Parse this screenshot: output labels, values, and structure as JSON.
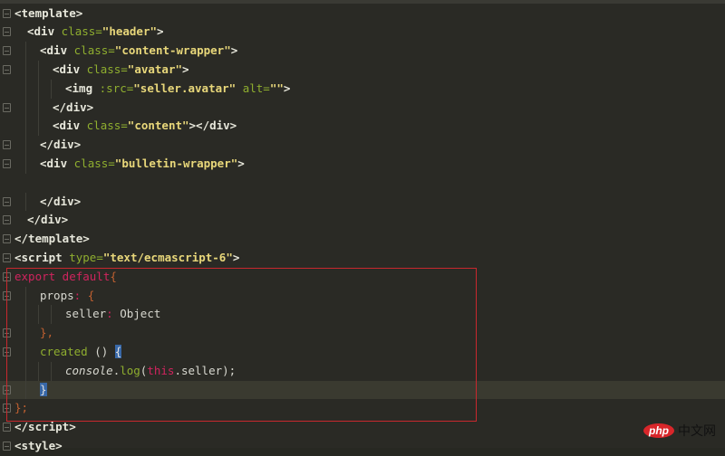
{
  "editor": {
    "current_line": 20,
    "lines": [
      {
        "indent": 0,
        "fold": true,
        "tokens": [
          {
            "t": "<template>",
            "c": "tag"
          }
        ]
      },
      {
        "indent": 1,
        "fold": true,
        "tokens": [
          {
            "t": "<div ",
            "c": "tag"
          },
          {
            "t": "class=",
            "c": "attr"
          },
          {
            "t": "\"header\"",
            "c": "str"
          },
          {
            "t": ">",
            "c": "tag"
          }
        ]
      },
      {
        "indent": 2,
        "fold": true,
        "tokens": [
          {
            "t": "<div ",
            "c": "tag"
          },
          {
            "t": "class=",
            "c": "attr"
          },
          {
            "t": "\"content-wrapper\"",
            "c": "str"
          },
          {
            "t": ">",
            "c": "tag"
          }
        ]
      },
      {
        "indent": 3,
        "fold": true,
        "tokens": [
          {
            "t": "<div ",
            "c": "tag"
          },
          {
            "t": "class=",
            "c": "attr"
          },
          {
            "t": "\"avatar\"",
            "c": "str"
          },
          {
            "t": ">",
            "c": "tag"
          }
        ]
      },
      {
        "indent": 4,
        "fold": false,
        "tokens": [
          {
            "t": "<img ",
            "c": "tag"
          },
          {
            "t": ":src=",
            "c": "attr"
          },
          {
            "t": "\"seller.avatar\"",
            "c": "str"
          },
          {
            "t": " alt=",
            "c": "attr"
          },
          {
            "t": "\"\"",
            "c": "str"
          },
          {
            "t": ">",
            "c": "tag"
          }
        ]
      },
      {
        "indent": 3,
        "fold": true,
        "tokens": [
          {
            "t": "</div>",
            "c": "tag"
          }
        ]
      },
      {
        "indent": 3,
        "fold": false,
        "tokens": [
          {
            "t": "<div ",
            "c": "tag"
          },
          {
            "t": "class=",
            "c": "attr"
          },
          {
            "t": "\"content\"",
            "c": "str"
          },
          {
            "t": "></div>",
            "c": "tag"
          }
        ]
      },
      {
        "indent": 2,
        "fold": true,
        "tokens": [
          {
            "t": "</div>",
            "c": "tag"
          }
        ]
      },
      {
        "indent": 2,
        "fold": true,
        "tokens": [
          {
            "t": "<div ",
            "c": "tag"
          },
          {
            "t": "class=",
            "c": "attr"
          },
          {
            "t": "\"bulletin-wrapper\"",
            "c": "str"
          },
          {
            "t": ">",
            "c": "tag"
          }
        ]
      },
      {
        "indent": 0,
        "fold": false,
        "tokens": []
      },
      {
        "indent": 2,
        "fold": true,
        "tokens": [
          {
            "t": "</div>",
            "c": "tag"
          }
        ]
      },
      {
        "indent": 1,
        "fold": true,
        "tokens": [
          {
            "t": "</div>",
            "c": "tag"
          }
        ]
      },
      {
        "indent": 0,
        "fold": true,
        "tokens": [
          {
            "t": "</template>",
            "c": "tag"
          }
        ]
      },
      {
        "indent": 0,
        "fold": true,
        "tokens": [
          {
            "t": "<script ",
            "c": "tag"
          },
          {
            "t": "type=",
            "c": "attr"
          },
          {
            "t": "\"text/ecmascript-6\"",
            "c": "str"
          },
          {
            "t": ">",
            "c": "tag"
          }
        ]
      },
      {
        "indent": 0,
        "fold": true,
        "tokens": [
          {
            "t": "export default",
            "c": "kw"
          },
          {
            "t": "{",
            "c": "punc"
          }
        ]
      },
      {
        "indent": 2,
        "fold": true,
        "tokens": [
          {
            "t": "props",
            "c": "txt"
          },
          {
            "t": ": ",
            "c": "kw"
          },
          {
            "t": "{",
            "c": "punc"
          }
        ]
      },
      {
        "indent": 4,
        "fold": false,
        "tokens": [
          {
            "t": "seller",
            "c": "txt"
          },
          {
            "t": ": ",
            "c": "kw"
          },
          {
            "t": "Object",
            "c": "txt"
          }
        ]
      },
      {
        "indent": 2,
        "fold": true,
        "tokens": [
          {
            "t": "},",
            "c": "punc"
          }
        ]
      },
      {
        "indent": 2,
        "fold": true,
        "tokens": [
          {
            "t": "created",
            "c": "fn"
          },
          {
            "t": " () ",
            "c": "txt"
          },
          {
            "t": "{",
            "c": "match"
          }
        ]
      },
      {
        "indent": 4,
        "fold": false,
        "tokens": [
          {
            "t": "console",
            "c": "it"
          },
          {
            "t": ".",
            "c": "txt"
          },
          {
            "t": "log",
            "c": "fn"
          },
          {
            "t": "(",
            "c": "txt"
          },
          {
            "t": "this",
            "c": "kw"
          },
          {
            "t": ".seller);",
            "c": "txt"
          }
        ]
      },
      {
        "indent": 2,
        "fold": true,
        "tokens": [
          {
            "t": "}",
            "c": "match"
          }
        ]
      },
      {
        "indent": 0,
        "fold": true,
        "tokens": [
          {
            "t": "};",
            "c": "punc"
          }
        ]
      },
      {
        "indent": 0,
        "fold": true,
        "tokens": [
          {
            "t": "</script>",
            "c": "tag"
          }
        ]
      },
      {
        "indent": 0,
        "fold": true,
        "tokens": [
          {
            "t": "<style>",
            "c": "tag"
          }
        ]
      }
    ]
  },
  "watermark": {
    "brand": "php",
    "text": "中文网"
  }
}
